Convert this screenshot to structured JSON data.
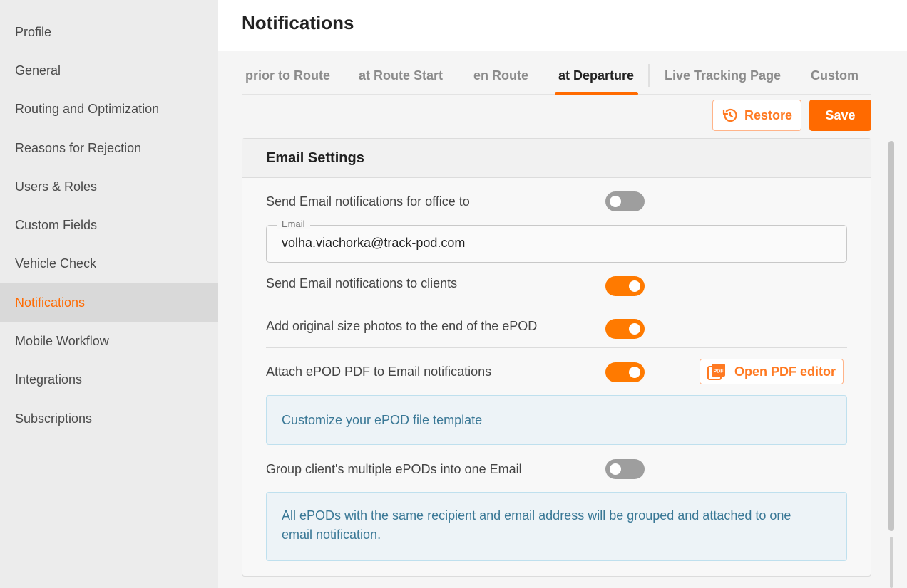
{
  "sidebar": {
    "items": [
      {
        "label": "Profile"
      },
      {
        "label": "General"
      },
      {
        "label": "Routing and Optimization"
      },
      {
        "label": "Reasons for Rejection"
      },
      {
        "label": "Users & Roles"
      },
      {
        "label": "Custom Fields"
      },
      {
        "label": "Vehicle Check"
      },
      {
        "label": "Notifications",
        "active": true
      },
      {
        "label": "Mobile Workflow"
      },
      {
        "label": "Integrations"
      },
      {
        "label": "Subscriptions"
      }
    ]
  },
  "header": {
    "title": "Notifications"
  },
  "tabs": [
    {
      "label": "prior to Route"
    },
    {
      "label": "at Route Start"
    },
    {
      "label": "en Route"
    },
    {
      "label": "at Departure",
      "active": true
    },
    {
      "label": "Live Tracking Page"
    },
    {
      "label": "Custom"
    }
  ],
  "actions": {
    "restore_label": "Restore",
    "save_label": "Save"
  },
  "email_settings": {
    "title": "Email Settings",
    "office_toggle_label": "Send Email notifications for office to",
    "office_toggle_on": false,
    "email_field_label": "Email",
    "email_value": "volha.viachorka@track-pod.com",
    "clients_toggle_label": "Send Email notifications to clients",
    "clients_toggle_on": true,
    "photos_toggle_label": "Add original size photos to the end of the ePOD",
    "photos_toggle_on": true,
    "attach_pdf_toggle_label": "Attach ePOD PDF to Email notifications",
    "attach_pdf_toggle_on": true,
    "open_pdf_editor_label": "Open PDF editor",
    "pdf_icon_text": "PDF",
    "customize_template_text": "Customize your ePOD file template",
    "group_toggle_label": "Group client's multiple ePODs into one Email",
    "group_toggle_on": false,
    "group_info_text": "All ePODs with the same recipient and email address will be grouped and attached to one email notification."
  },
  "colors": {
    "accent": "#ff6a00",
    "info_text": "#3a7896",
    "info_bg": "#edf3f7",
    "toggle_off": "#9e9e9e"
  },
  "icons": {
    "restore": "history-icon",
    "pdf": "pdf-file-icon"
  }
}
